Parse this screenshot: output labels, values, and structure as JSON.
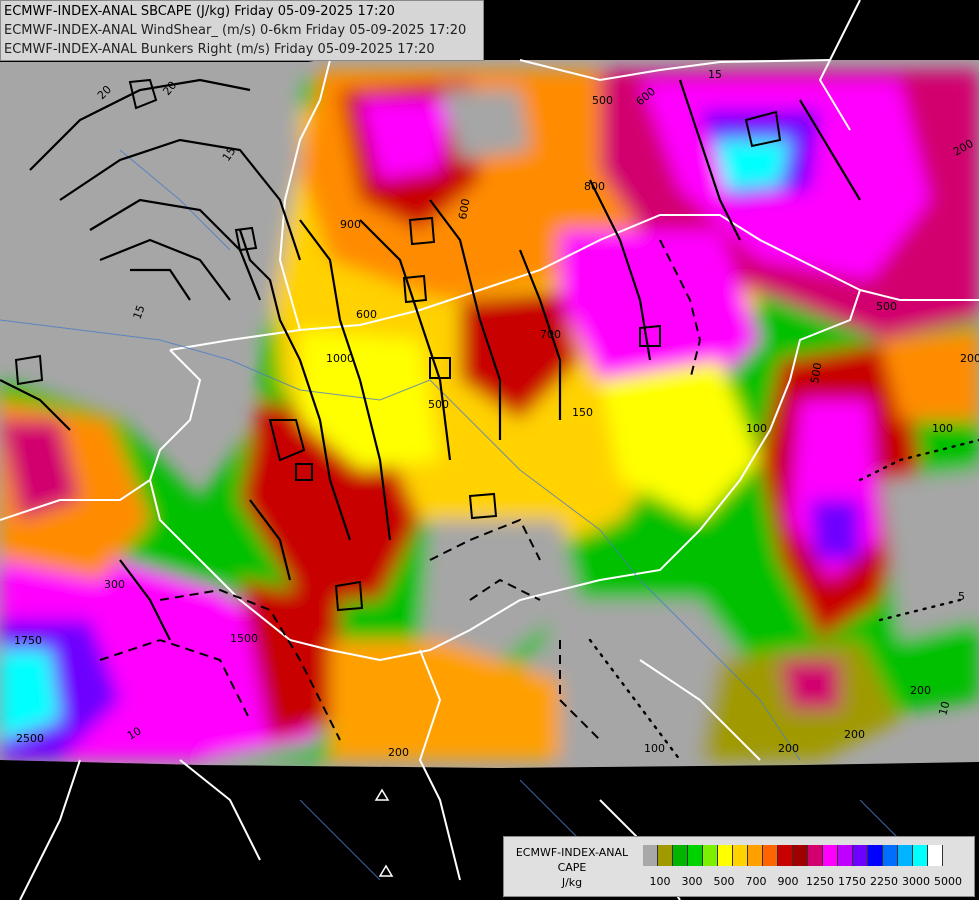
{
  "header": {
    "line1": "ECMWF-INDEX-ANAL SBCAPE (J/kg) Friday 05-09-2025 17:20",
    "line2": "ECMWF-INDEX-ANAL WindShear_ (m/s) 0-6km Friday 05-09-2025 17:20",
    "line3": "ECMWF-INDEX-ANAL Bunkers Right (m/s) Friday 05-09-2025 17:20"
  },
  "legend": {
    "title1": "ECMWF-INDEX-ANAL",
    "title2": "CAPE",
    "unit": "J/kg",
    "colors": [
      "#a8a8a8",
      "#a09a00",
      "#00b400",
      "#00d200",
      "#7bf000",
      "#ffff00",
      "#ffd200",
      "#ffa000",
      "#ff6400",
      "#c80000",
      "#a00000",
      "#d2006e",
      "#ff00ff",
      "#c000ff",
      "#6e00ff",
      "#0000ff",
      "#006eff",
      "#00b4ff",
      "#00ffff",
      "#ffffff"
    ],
    "tick_labels": [
      "100",
      "300",
      "500",
      "700",
      "900",
      "1250",
      "1750",
      "2250",
      "3000",
      "5000"
    ]
  },
  "map_labels": [
    {
      "text": "20"
    },
    {
      "text": "20"
    },
    {
      "text": "15"
    },
    {
      "text": "15"
    },
    {
      "text": "15"
    },
    {
      "text": "500"
    },
    {
      "text": "600"
    },
    {
      "text": "900"
    },
    {
      "text": "600"
    },
    {
      "text": "600"
    },
    {
      "text": "1000"
    },
    {
      "text": "500"
    },
    {
      "text": "150"
    },
    {
      "text": "800"
    },
    {
      "text": "500"
    },
    {
      "text": "300"
    },
    {
      "text": "700"
    },
    {
      "text": "1750"
    },
    {
      "text": "1500"
    },
    {
      "text": "2500"
    },
    {
      "text": "10"
    },
    {
      "text": "200"
    },
    {
      "text": "100"
    },
    {
      "text": "200"
    },
    {
      "text": "200"
    },
    {
      "text": "100"
    },
    {
      "text": "200"
    },
    {
      "text": "200"
    },
    {
      "text": "5"
    },
    {
      "text": "10"
    },
    {
      "text": "100"
    },
    {
      "text": "200"
    },
    {
      "text": "500"
    }
  ]
}
